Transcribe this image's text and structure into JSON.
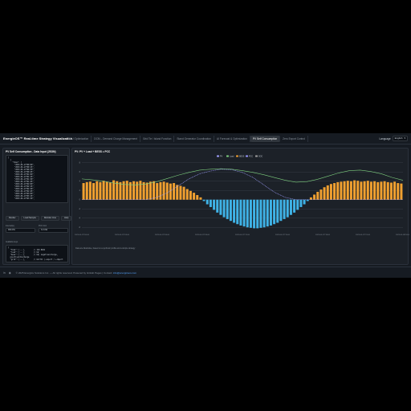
{
  "header": {
    "brand": "EnergieOS™ Real-time Strategy Visualization",
    "tabs": [
      {
        "label": "TOU Optimization"
      },
      {
        "label": "DCM – Demand Charge Management"
      },
      {
        "label": "Grid Tie / Island Function"
      },
      {
        "label": "Stand Generator Coordination"
      },
      {
        "label": "AI Forecast & Optimization"
      },
      {
        "label": "PV Self Consumption"
      },
      {
        "label": "Zero Export Control"
      }
    ],
    "active_tab": 5,
    "language_label": "Language",
    "language_value": "English"
  },
  "left_panel": {
    "title": "PV Self Consumption - Data Input (JSON)",
    "json_lines": [
      "[",
      "  {",
      "    \"time\": [",
      "      \"2023-06-17T00:00\",",
      "      \"2023-06-17T00:15\",",
      "      \"2023-06-17T00:30\",",
      "      \"2023-06-17T00:45\",",
      "      \"2023-06-17T01:00\",",
      "      \"2023-06-17T01:15\",",
      "      \"2023-06-17T01:30\",",
      "      \"2023-06-17T01:45\",",
      "      \"2023-06-17T02:00\",",
      "      \"2023-06-17T02:15\",",
      "      \"2023-06-17T02:30\",",
      "      \"2023-06-17T02:45\",",
      "      \"2023-06-17T03:00\",",
      "      \"2023-06-17T03:15\",",
      "      \"2023-06-17T03:30\","
    ],
    "buttons": [
      "Render",
      "Load Sample",
      "Reindex time",
      "Help"
    ],
    "field1_label": "Interval(s)",
    "field1_value": "900.0%",
    "field2_label": "PCC limit",
    "field2_value": "6.0 kW",
    "hint_label": "Available keys",
    "legend_lines": [
      "{",
      "  \"time\": [...],        // ISO 8601",
      "  \"load\": [...],        // kW",
      "  \"bess\": [...],        // kW; negative=charge,",
      "  positive=discharge",
      "  \"grid\": [...],        // kW PCC (-export / +import"
    ]
  },
  "chart_panel": {
    "title": "PV: PV + Load + BESS = PCC",
    "note": "Data are illustrative, based on a synthetic profile and a simple strategy"
  },
  "chart_data": {
    "type": "bar",
    "title": "PV: PV + Load + BESS = PCC",
    "x_tick_labels": [
      "2023-06-17T00:00",
      "2023-06-17T03:00",
      "2023-06-17T06:00",
      "2023-06-17T09:00",
      "2023-06-17T12:00",
      "2023-06-17T15:00",
      "2023-06-17T18:00",
      "2023-06-17T21:00",
      "2023-06-18T00:00"
    ],
    "y_tick_labels": [
      "8",
      "6",
      "4",
      "2",
      "0",
      "-2",
      "-4",
      "-6"
    ],
    "ylim": [
      -7,
      9
    ],
    "legend": [
      "PV",
      "Load",
      "BESS",
      "PCC",
      "SOC"
    ],
    "legend_placement": "top-center",
    "grid": true,
    "series_colors": {
      "PV": "#a0a0ff",
      "Load": "#7fd07f",
      "BESS": "#f0a030",
      "PCC": "#9898ff",
      "SOC": "#a0a0a0",
      "BESS_neg": "#3fb2e6"
    },
    "series": [
      {
        "name": "BESS",
        "values": [
          3.6,
          3.8,
          3.9,
          3.6,
          4.0,
          3.8,
          4.1,
          3.9,
          3.7,
          4.2,
          4.0,
          3.8,
          4.0,
          4.1,
          3.8,
          4.0,
          3.9,
          4.1,
          3.8,
          3.7,
          3.9,
          4.0,
          3.6,
          3.8,
          3.9,
          3.7,
          3.5,
          3.6,
          3.2,
          3.0,
          2.8,
          2.3,
          1.9,
          1.5,
          1.0,
          0.5,
          -0.3,
          -1.0,
          -1.6,
          -2.2,
          -2.8,
          -3.3,
          -3.8,
          -4.2,
          -4.6,
          -5.0,
          -5.3,
          -5.6,
          -5.8,
          -6.0,
          -6.1,
          -6.2,
          -6.2,
          -6.1,
          -6.0,
          -5.8,
          -5.6,
          -5.3,
          -5.0,
          -4.6,
          -4.2,
          -3.8,
          -3.3,
          -2.8,
          -2.2,
          -1.6,
          -1.0,
          -0.3,
          0.5,
          1.1,
          1.7,
          2.2,
          2.7,
          3.1,
          3.4,
          3.6,
          3.8,
          3.9,
          4.0,
          4.1,
          4.0,
          4.2,
          4.1,
          3.9,
          4.0,
          4.1,
          3.9,
          4.0,
          3.8,
          3.9,
          4.0,
          3.8,
          3.7,
          3.9,
          3.6,
          3.5
        ]
      },
      {
        "name": "Load",
        "values": [
          4.5,
          4.3,
          4.0,
          3.6,
          3.3,
          3.2,
          3.4,
          3.9,
          4.6,
          5.3,
          5.9,
          6.4,
          6.6,
          6.7,
          6.6,
          6.3,
          5.9,
          5.4,
          4.8,
          4.2,
          3.8,
          3.9,
          4.4,
          5.1,
          5.8,
          6.3,
          6.4,
          6.1,
          5.6,
          4.8,
          4.2
        ]
      },
      {
        "name": "PV",
        "values": [
          0,
          0,
          0,
          0,
          0,
          0,
          0,
          0.5,
          1.5,
          3.0,
          4.5,
          5.6,
          6.2,
          6.6,
          6.5,
          5.9,
          4.8,
          3.2,
          1.6,
          0.5,
          0,
          0,
          0,
          0,
          0,
          0,
          0,
          0,
          0,
          0,
          0
        ]
      }
    ]
  }
}
